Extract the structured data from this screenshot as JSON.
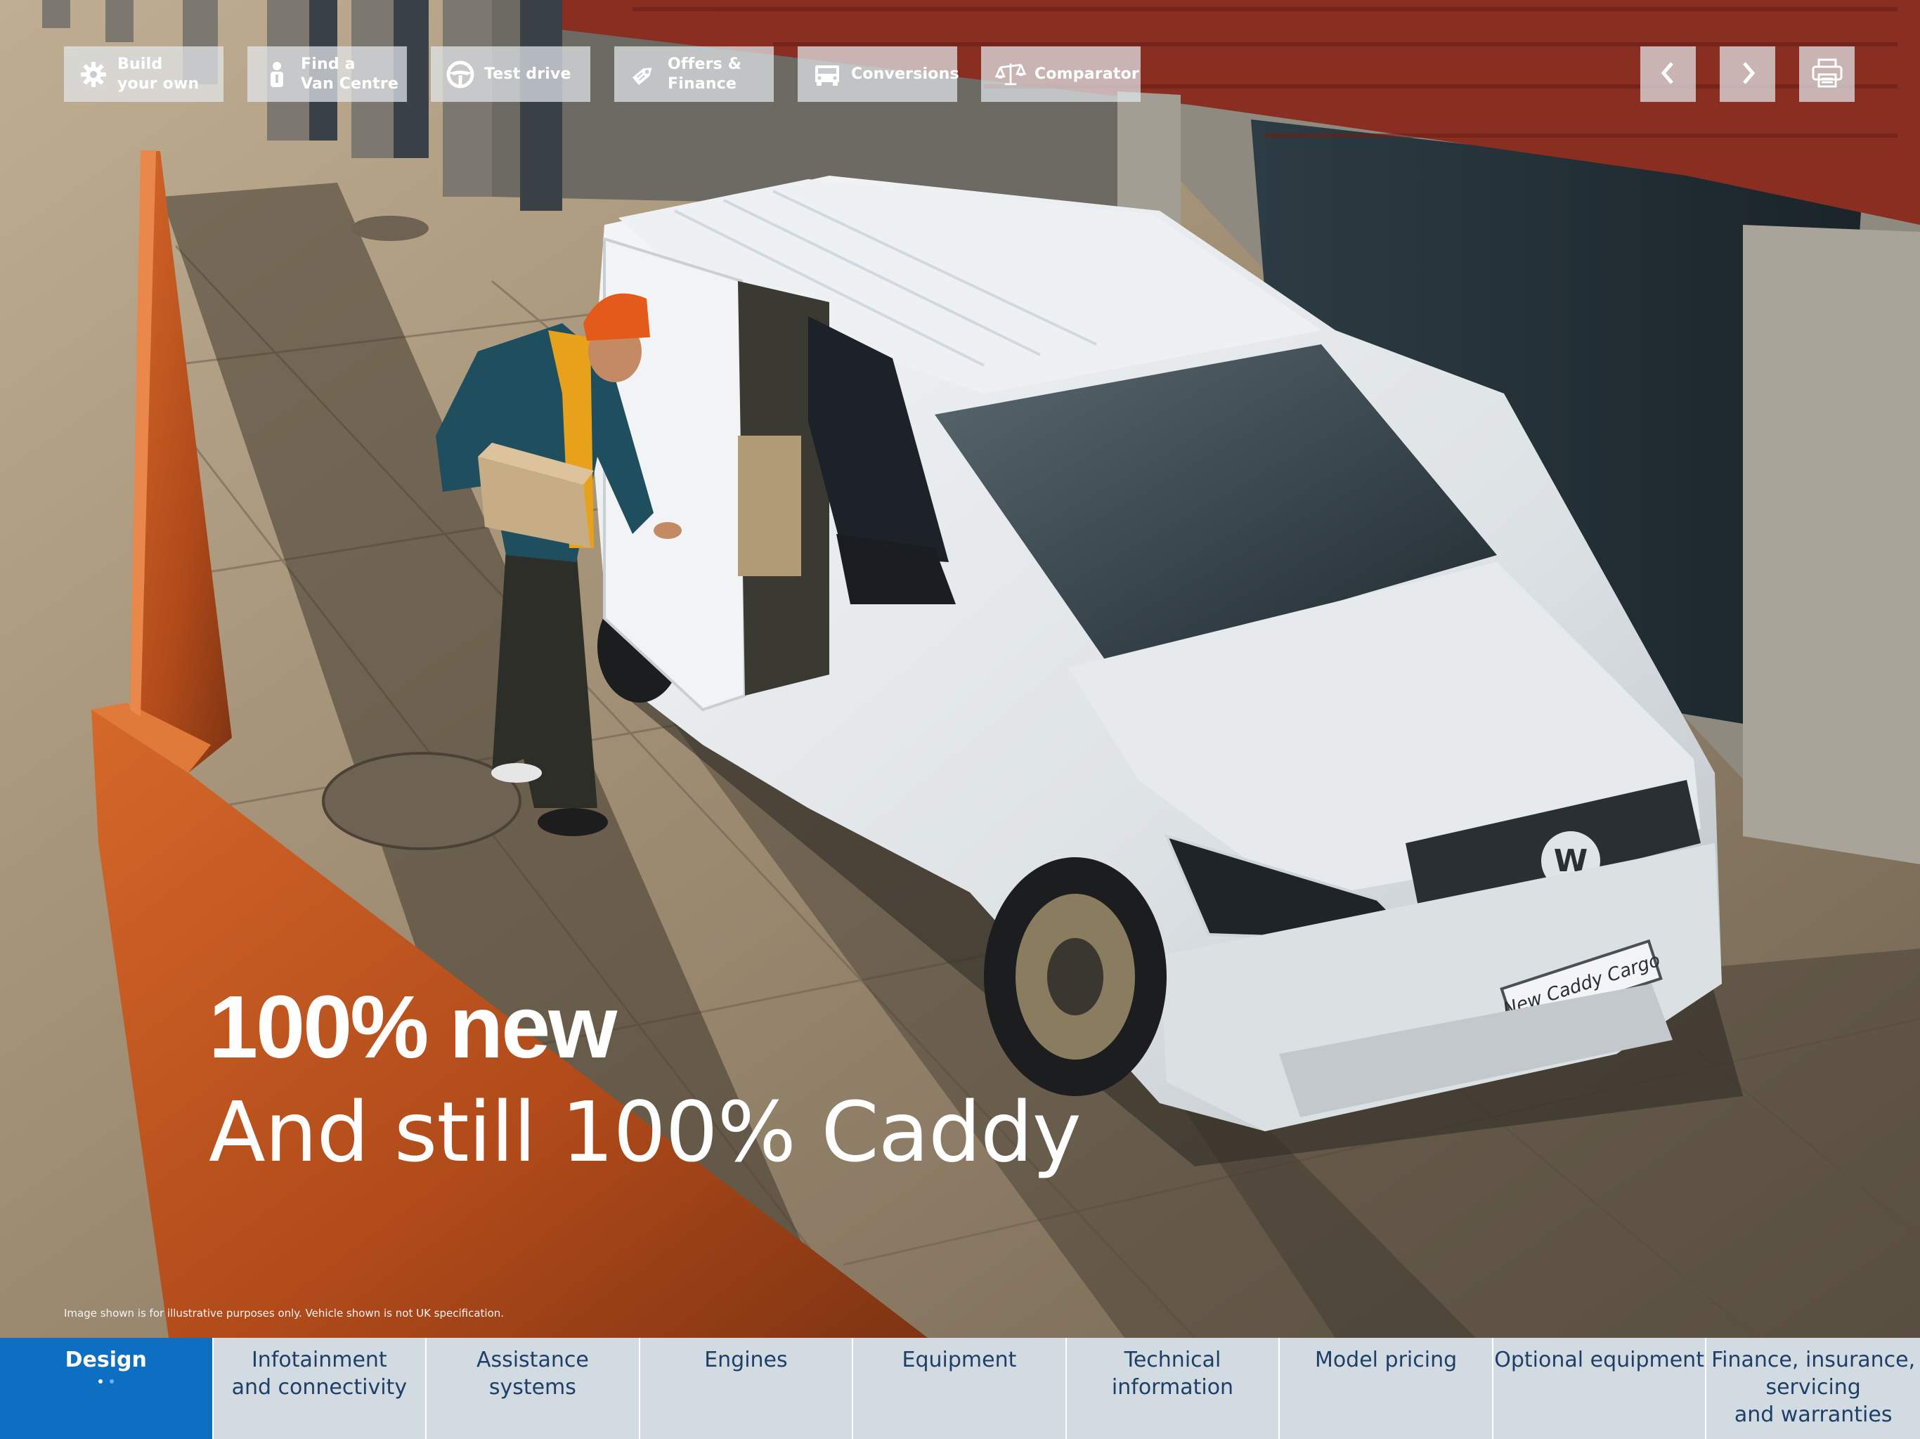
{
  "toolbar": {
    "buttons": [
      {
        "label": "Build\nyour own",
        "icon": "gear-icon"
      },
      {
        "label": "Find a\nVan Centre",
        "icon": "person-icon"
      },
      {
        "label": "Test drive",
        "icon": "steering-wheel-icon"
      },
      {
        "label": "Offers &\nFinance",
        "icon": "price-tag-icon"
      },
      {
        "label": "Conversions",
        "icon": "van-icon"
      },
      {
        "label": "Comparator",
        "icon": "scales-icon"
      }
    ]
  },
  "nav": {
    "prev_icon": "chevron-left-icon",
    "next_icon": "chevron-right-icon",
    "print_icon": "printer-icon"
  },
  "hero": {
    "headline": "100% new",
    "subheadline": "And still 100% Caddy",
    "disclaimer": "Image shown is for illustrative purposes only. Vehicle shown is not UK specification.",
    "plate_text": "New Caddy Cargo"
  },
  "tabs": [
    {
      "label": "Design",
      "active": true
    },
    {
      "label": "Infotainment\nand connectivity",
      "active": false
    },
    {
      "label": "Assistance\nsystems",
      "active": false
    },
    {
      "label": "Engines",
      "active": false
    },
    {
      "label": "Equipment",
      "active": false
    },
    {
      "label": "Technical\ninformation",
      "active": false
    },
    {
      "label": "Model pricing",
      "active": false
    },
    {
      "label": "Optional equipment",
      "active": false
    },
    {
      "label": "Finance, insurance,\nservicing\nand warranties",
      "active": false
    }
  ],
  "pagination": {
    "current": 1,
    "total": 2
  },
  "colors": {
    "active_tab": "#0c6fc2",
    "tab_bar": "#d3dbe2",
    "tab_text": "#1f3f66",
    "toolbar_button": "#e2e7ec",
    "rust_wall": "#b8501f"
  }
}
